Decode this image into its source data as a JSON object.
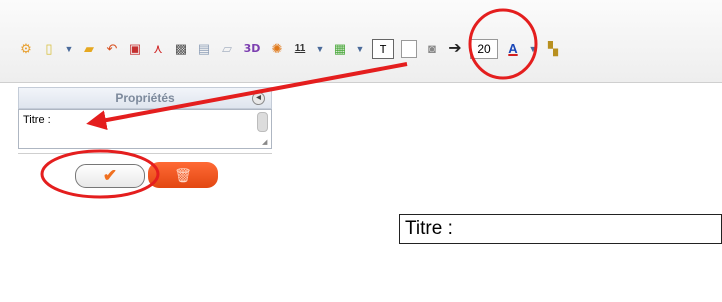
{
  "toolbar": {
    "label_3d": "3D",
    "calendar_day": "11",
    "text_tool": "T",
    "font_size": "20",
    "font_color_glyph": "A"
  },
  "panel": {
    "header": "Propriétés",
    "property_text": "Titre :"
  },
  "canvas": {
    "title_field_value": "Titre :"
  },
  "colors": {
    "annotation_red": "#e41e1e",
    "ok_check": "#f07020",
    "delete_button": "#ef5520",
    "panel_header_text": "#7d8a9c"
  }
}
